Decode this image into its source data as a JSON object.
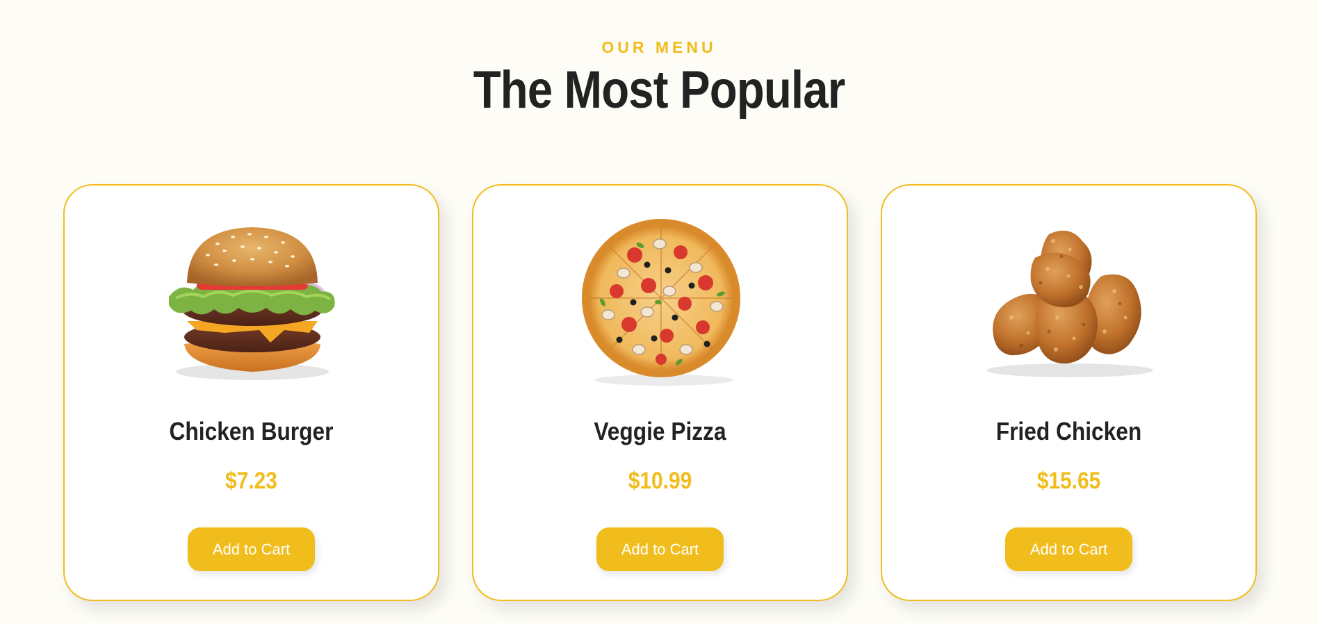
{
  "header": {
    "eyebrow": "OUR MENU",
    "title": "The Most Popular"
  },
  "menu": {
    "items": [
      {
        "name": "Chicken Burger",
        "price": "$7.23",
        "button_label": "Add to Cart",
        "image": "burger-image"
      },
      {
        "name": "Veggie Pizza",
        "price": "$10.99",
        "button_label": "Add to Cart",
        "image": "pizza-image"
      },
      {
        "name": "Fried Chicken",
        "price": "$15.65",
        "button_label": "Add to Cart",
        "image": "fried-chicken-image"
      }
    ]
  },
  "colors": {
    "accent": "#f0bd1c",
    "text": "#222222",
    "background": "#fdfcf6",
    "card": "#ffffff"
  }
}
